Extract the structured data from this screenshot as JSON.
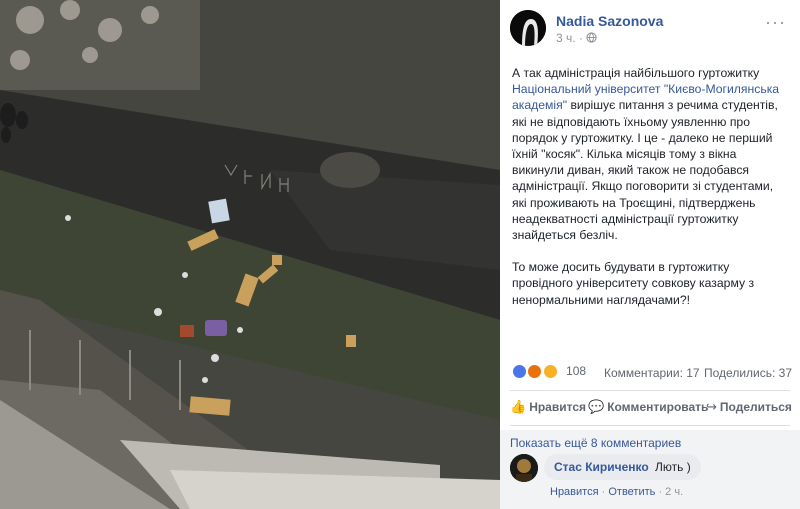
{
  "post": {
    "author": "Nadia Sazonova",
    "time": "3 ч.",
    "privacy_icon": "globe-icon",
    "more_label": "···",
    "text_part1": "А так адміністрація найбільшого гуртожитку ",
    "text_link": "Національний університет \"Києво-Могилянська академія\"",
    "text_part2": " вирішує питання з речима студентів, які не відповідають їхньому уявленню про порядок у гуртожитку. І це - далеко не перший їхній \"косяк\". Кілька місяців тому з вікна викинули диван, який також не подобався адміністрації. Якщо поговорити зі студентами, які проживають на Троєщині, підтверджень неадекватності адміністрації гуртожитку знайдеться безліч.",
    "text_paragraph2": "То може досить будувати в гуртожитку провідного університету совкову казарму з ненормальними наглядачами?!"
  },
  "stats": {
    "reactions_count": "108",
    "comments": "Комментарии: 17",
    "shares": "Поделились: 37",
    "colors": {
      "like": "#4a76e8",
      "angry": "#e9710f",
      "wow": "#f7b125"
    }
  },
  "actions": {
    "like": "Нравится",
    "comment": "Комментировать",
    "share": "Поделиться"
  },
  "comments": {
    "show_more": "Показать ещё 8 комментариев",
    "items": [
      {
        "author": "Стас Кириченко",
        "text": "Лють )",
        "like": "Нравится",
        "reply": "Ответить",
        "time": "2 ч."
      }
    ]
  }
}
